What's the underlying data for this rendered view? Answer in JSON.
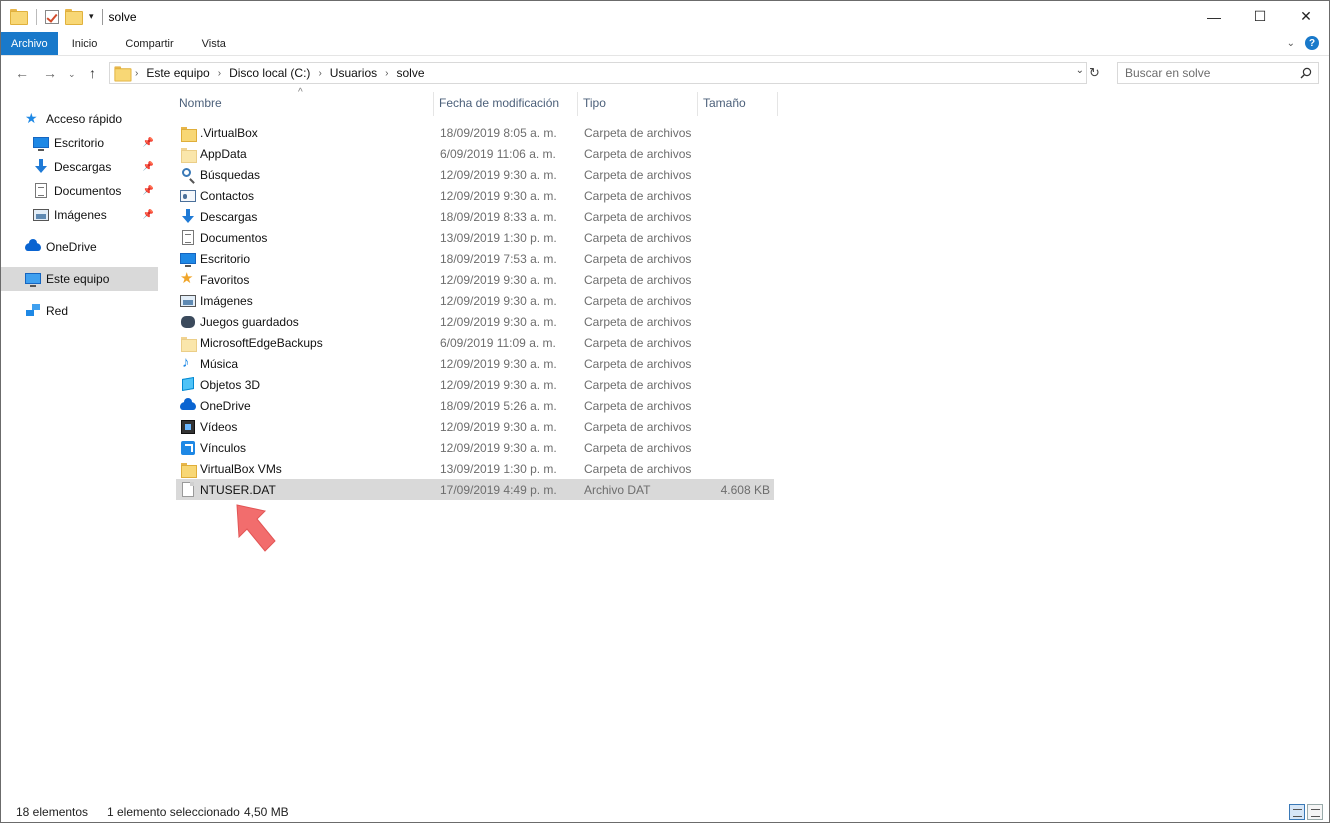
{
  "window": {
    "title": "solve",
    "controls": {
      "minimize": "—",
      "maximize": "☐",
      "close": "✕"
    }
  },
  "ribbon": {
    "tabs": [
      "Archivo",
      "Inicio",
      "Compartir",
      "Vista"
    ],
    "help": "?"
  },
  "address": {
    "crumbs": [
      "Este equipo",
      "Disco local (C:)",
      "Usuarios",
      "solve"
    ],
    "search_placeholder": "Buscar en solve"
  },
  "sidebar": {
    "quick_access": "Acceso rápido",
    "quick_items": [
      {
        "label": "Escritorio",
        "icon": "desktop-icon",
        "pinned": true
      },
      {
        "label": "Descargas",
        "icon": "downloads-icon",
        "pinned": true
      },
      {
        "label": "Documentos",
        "icon": "documents-icon",
        "pinned": true
      },
      {
        "label": "Imágenes",
        "icon": "pictures-icon",
        "pinned": true
      }
    ],
    "onedrive": "OneDrive",
    "this_pc": "Este equipo",
    "network": "Red"
  },
  "columns": {
    "name": "Nombre",
    "date": "Fecha de modificación",
    "type": "Tipo",
    "size": "Tamaño"
  },
  "files": [
    {
      "name": ".VirtualBox",
      "date": "18/09/2019 8:05 a. m.",
      "type": "Carpeta de archivos",
      "size": "",
      "icon": "folder-icon"
    },
    {
      "name": "AppData",
      "date": "6/09/2019 11:06 a. m.",
      "type": "Carpeta de archivos",
      "size": "",
      "icon": "folder-icon"
    },
    {
      "name": "Búsquedas",
      "date": "12/09/2019 9:30 a. m.",
      "type": "Carpeta de archivos",
      "size": "",
      "icon": "search-folder-icon"
    },
    {
      "name": "Contactos",
      "date": "12/09/2019 9:30 a. m.",
      "type": "Carpeta de archivos",
      "size": "",
      "icon": "contacts-icon"
    },
    {
      "name": "Descargas",
      "date": "18/09/2019 8:33 a. m.",
      "type": "Carpeta de archivos",
      "size": "",
      "icon": "downloads-icon"
    },
    {
      "name": "Documentos",
      "date": "13/09/2019 1:30 p. m.",
      "type": "Carpeta de archivos",
      "size": "",
      "icon": "documents-icon"
    },
    {
      "name": "Escritorio",
      "date": "18/09/2019 7:53 a. m.",
      "type": "Carpeta de archivos",
      "size": "",
      "icon": "desktop-icon"
    },
    {
      "name": "Favoritos",
      "date": "12/09/2019 9:30 a. m.",
      "type": "Carpeta de archivos",
      "size": "",
      "icon": "favorites-icon"
    },
    {
      "name": "Imágenes",
      "date": "12/09/2019 9:30 a. m.",
      "type": "Carpeta de archivos",
      "size": "",
      "icon": "pictures-icon"
    },
    {
      "name": "Juegos guardados",
      "date": "12/09/2019 9:30 a. m.",
      "type": "Carpeta de archivos",
      "size": "",
      "icon": "saved-games-icon"
    },
    {
      "name": "MicrosoftEdgeBackups",
      "date": "6/09/2019 11:09 a. m.",
      "type": "Carpeta de archivos",
      "size": "",
      "icon": "folder-icon"
    },
    {
      "name": "Música",
      "date": "12/09/2019 9:30 a. m.",
      "type": "Carpeta de archivos",
      "size": "",
      "icon": "music-icon"
    },
    {
      "name": "Objetos 3D",
      "date": "12/09/2019 9:30 a. m.",
      "type": "Carpeta de archivos",
      "size": "",
      "icon": "3d-objects-icon"
    },
    {
      "name": "OneDrive",
      "date": "18/09/2019 5:26 a. m.",
      "type": "Carpeta de archivos",
      "size": "",
      "icon": "onedrive-icon"
    },
    {
      "name": "Vídeos",
      "date": "12/09/2019 9:30 a. m.",
      "type": "Carpeta de archivos",
      "size": "",
      "icon": "videos-icon"
    },
    {
      "name": "Vínculos",
      "date": "12/09/2019 9:30 a. m.",
      "type": "Carpeta de archivos",
      "size": "",
      "icon": "links-icon"
    },
    {
      "name": "VirtualBox VMs",
      "date": "13/09/2019 1:30 p. m.",
      "type": "Carpeta de archivos",
      "size": "",
      "icon": "folder-icon"
    },
    {
      "name": "NTUSER.DAT",
      "date": "17/09/2019 4:49 p. m.",
      "type": "Archivo DAT",
      "size": "4.608 KB",
      "icon": "file-icon",
      "selected": true
    }
  ],
  "status": {
    "count": "18 elementos",
    "selection": "1 elemento seleccionado",
    "selection_size": "4,50 MB"
  },
  "colors": {
    "accent": "#1979ca",
    "selection": "#d9d9d9",
    "annotation_arrow": "#f26d6d"
  }
}
